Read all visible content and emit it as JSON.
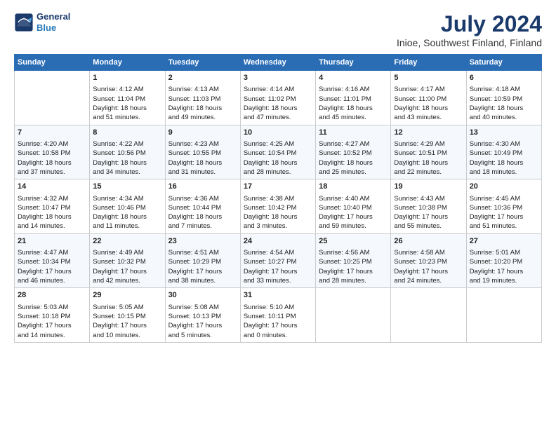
{
  "app": {
    "logo_line1": "General",
    "logo_line2": "Blue"
  },
  "title": "July 2024",
  "subtitle": "Inioe, Southwest Finland, Finland",
  "days_of_week": [
    "Sunday",
    "Monday",
    "Tuesday",
    "Wednesday",
    "Thursday",
    "Friday",
    "Saturday"
  ],
  "weeks": [
    [
      {
        "day": "",
        "info": ""
      },
      {
        "day": "1",
        "info": "Sunrise: 4:12 AM\nSunset: 11:04 PM\nDaylight: 18 hours\nand 51 minutes."
      },
      {
        "day": "2",
        "info": "Sunrise: 4:13 AM\nSunset: 11:03 PM\nDaylight: 18 hours\nand 49 minutes."
      },
      {
        "day": "3",
        "info": "Sunrise: 4:14 AM\nSunset: 11:02 PM\nDaylight: 18 hours\nand 47 minutes."
      },
      {
        "day": "4",
        "info": "Sunrise: 4:16 AM\nSunset: 11:01 PM\nDaylight: 18 hours\nand 45 minutes."
      },
      {
        "day": "5",
        "info": "Sunrise: 4:17 AM\nSunset: 11:00 PM\nDaylight: 18 hours\nand 43 minutes."
      },
      {
        "day": "6",
        "info": "Sunrise: 4:18 AM\nSunset: 10:59 PM\nDaylight: 18 hours\nand 40 minutes."
      }
    ],
    [
      {
        "day": "7",
        "info": "Sunrise: 4:20 AM\nSunset: 10:58 PM\nDaylight: 18 hours\nand 37 minutes."
      },
      {
        "day": "8",
        "info": "Sunrise: 4:22 AM\nSunset: 10:56 PM\nDaylight: 18 hours\nand 34 minutes."
      },
      {
        "day": "9",
        "info": "Sunrise: 4:23 AM\nSunset: 10:55 PM\nDaylight: 18 hours\nand 31 minutes."
      },
      {
        "day": "10",
        "info": "Sunrise: 4:25 AM\nSunset: 10:54 PM\nDaylight: 18 hours\nand 28 minutes."
      },
      {
        "day": "11",
        "info": "Sunrise: 4:27 AM\nSunset: 10:52 PM\nDaylight: 18 hours\nand 25 minutes."
      },
      {
        "day": "12",
        "info": "Sunrise: 4:29 AM\nSunset: 10:51 PM\nDaylight: 18 hours\nand 22 minutes."
      },
      {
        "day": "13",
        "info": "Sunrise: 4:30 AM\nSunset: 10:49 PM\nDaylight: 18 hours\nand 18 minutes."
      }
    ],
    [
      {
        "day": "14",
        "info": "Sunrise: 4:32 AM\nSunset: 10:47 PM\nDaylight: 18 hours\nand 14 minutes."
      },
      {
        "day": "15",
        "info": "Sunrise: 4:34 AM\nSunset: 10:46 PM\nDaylight: 18 hours\nand 11 minutes."
      },
      {
        "day": "16",
        "info": "Sunrise: 4:36 AM\nSunset: 10:44 PM\nDaylight: 18 hours\nand 7 minutes."
      },
      {
        "day": "17",
        "info": "Sunrise: 4:38 AM\nSunset: 10:42 PM\nDaylight: 18 hours\nand 3 minutes."
      },
      {
        "day": "18",
        "info": "Sunrise: 4:40 AM\nSunset: 10:40 PM\nDaylight: 17 hours\nand 59 minutes."
      },
      {
        "day": "19",
        "info": "Sunrise: 4:43 AM\nSunset: 10:38 PM\nDaylight: 17 hours\nand 55 minutes."
      },
      {
        "day": "20",
        "info": "Sunrise: 4:45 AM\nSunset: 10:36 PM\nDaylight: 17 hours\nand 51 minutes."
      }
    ],
    [
      {
        "day": "21",
        "info": "Sunrise: 4:47 AM\nSunset: 10:34 PM\nDaylight: 17 hours\nand 46 minutes."
      },
      {
        "day": "22",
        "info": "Sunrise: 4:49 AM\nSunset: 10:32 PM\nDaylight: 17 hours\nand 42 minutes."
      },
      {
        "day": "23",
        "info": "Sunrise: 4:51 AM\nSunset: 10:29 PM\nDaylight: 17 hours\nand 38 minutes."
      },
      {
        "day": "24",
        "info": "Sunrise: 4:54 AM\nSunset: 10:27 PM\nDaylight: 17 hours\nand 33 minutes."
      },
      {
        "day": "25",
        "info": "Sunrise: 4:56 AM\nSunset: 10:25 PM\nDaylight: 17 hours\nand 28 minutes."
      },
      {
        "day": "26",
        "info": "Sunrise: 4:58 AM\nSunset: 10:23 PM\nDaylight: 17 hours\nand 24 minutes."
      },
      {
        "day": "27",
        "info": "Sunrise: 5:01 AM\nSunset: 10:20 PM\nDaylight: 17 hours\nand 19 minutes."
      }
    ],
    [
      {
        "day": "28",
        "info": "Sunrise: 5:03 AM\nSunset: 10:18 PM\nDaylight: 17 hours\nand 14 minutes."
      },
      {
        "day": "29",
        "info": "Sunrise: 5:05 AM\nSunset: 10:15 PM\nDaylight: 17 hours\nand 10 minutes."
      },
      {
        "day": "30",
        "info": "Sunrise: 5:08 AM\nSunset: 10:13 PM\nDaylight: 17 hours\nand 5 minutes."
      },
      {
        "day": "31",
        "info": "Sunrise: 5:10 AM\nSunset: 10:11 PM\nDaylight: 17 hours\nand 0 minutes."
      },
      {
        "day": "",
        "info": ""
      },
      {
        "day": "",
        "info": ""
      },
      {
        "day": "",
        "info": ""
      }
    ]
  ]
}
